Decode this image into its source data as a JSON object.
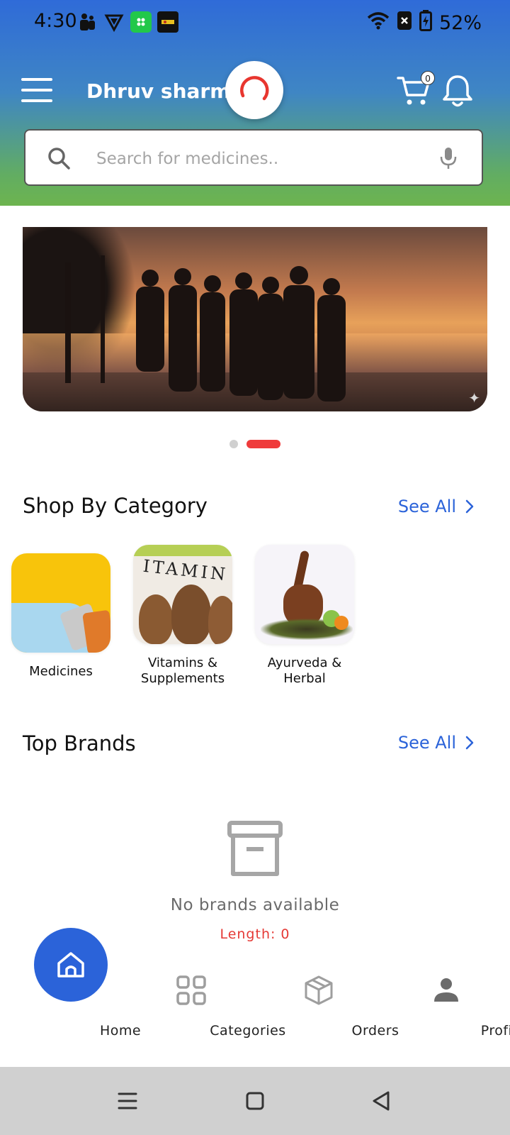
{
  "status_bar": {
    "time": "4:30",
    "battery": "52%"
  },
  "header": {
    "user_name": "Dhruv sharma",
    "cart_count": "0"
  },
  "search": {
    "placeholder": "Search for medicines.."
  },
  "carousel": {
    "active_index": 1,
    "count": 2
  },
  "categories_section": {
    "title": "Shop By Category",
    "see_all": "See All",
    "items": [
      {
        "label_line1": "Medicines",
        "label_line2": ""
      },
      {
        "label_line1": "Vitamins &",
        "label_line2": "Supplements"
      },
      {
        "label_line1": "Ayurveda &",
        "label_line2": "Herbal"
      }
    ]
  },
  "brands_section": {
    "title": "Top Brands",
    "see_all": "See All",
    "empty_message": "No brands available",
    "length_text": "Length: 0"
  },
  "bottom_nav": {
    "items": [
      {
        "label": "Home",
        "icon": "home-icon",
        "active": true
      },
      {
        "label": "Categories",
        "icon": "grid-icon",
        "active": false
      },
      {
        "label": "Orders",
        "icon": "package-icon",
        "active": false
      },
      {
        "label": "Profile",
        "icon": "person-icon",
        "active": false
      }
    ]
  },
  "colors": {
    "accent_blue": "#2b63d9",
    "header_gradient_top": "#2f6bd8",
    "header_gradient_bottom": "#6db44f",
    "indicator_red": "#ef3b3b",
    "error_red": "#e53935"
  }
}
